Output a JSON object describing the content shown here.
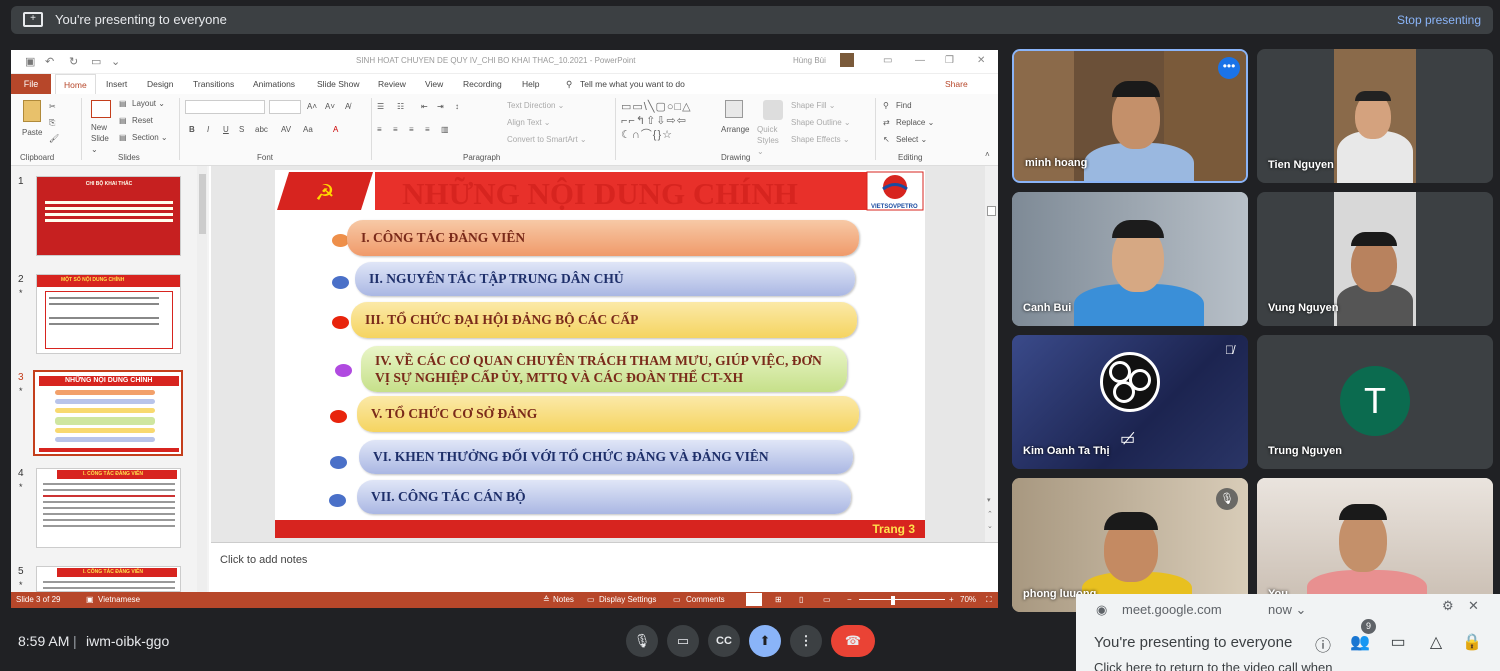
{
  "meet": {
    "presenting_text": "You're presenting to everyone",
    "stop_presenting": "Stop presenting",
    "time": "8:59 AM",
    "separator": "|",
    "meeting_code": "iwm-oibk-ggo",
    "participants_badge": "9",
    "toast": {
      "url": "meet.google.com",
      "when": "now ⌄",
      "message": "You're presenting to everyone",
      "sub": "Click here to return to the video call when"
    }
  },
  "powerpoint": {
    "doc_title": "SINH HOAT CHUYEN DE QUY IV_CHI BO KHAI THAC_10.2021  -  PowerPoint",
    "user": "Hùng Bùi",
    "tabs": [
      "File",
      "Home",
      "Insert",
      "Design",
      "Transitions",
      "Animations",
      "Slide Show",
      "Review",
      "View",
      "Recording",
      "Help",
      "Tell me what you want to do",
      "Share"
    ],
    "ribbon": {
      "paste": "Paste",
      "new_slide": "New Slide ⌄",
      "layout": "Layout ⌄",
      "reset": "Reset",
      "section": "Section ⌄",
      "text_direction": "Text Direction ⌄",
      "align_text": "Align Text ⌄",
      "convert_smartart": "Convert to SmartArt ⌄",
      "arrange": "Arrange",
      "quick_styles": "Quick Styles ⌄",
      "shape_fill": "Shape Fill ⌄",
      "shape_outline": "Shape Outline ⌄",
      "shape_effects": "Shape Effects ⌄",
      "find": "Find",
      "replace": "Replace ⌄",
      "select": "Select ⌄",
      "groups": [
        "Clipboard",
        "Slides",
        "Font",
        "Paragraph",
        "Drawing",
        "Editing"
      ]
    },
    "thumbnails": [
      {
        "num": "1",
        "title": "CHI BỘ KHAI THÁC"
      },
      {
        "num": "2",
        "title": "MỘT SỐ NỘI DUNG CHÍNH"
      },
      {
        "num": "3",
        "title": "NHỮNG NỘI DUNG CHÍNH"
      },
      {
        "num": "4",
        "title": "I. CÔNG TÁC ĐẢNG VIÊN"
      },
      {
        "num": "5",
        "title": "I. CÔNG TÁC ĐẢNG VIÊN"
      }
    ],
    "slide": {
      "title": "NHỮNG NỘI DUNG CHÍNH",
      "logo_text": "VIETSOVPETRO",
      "items": [
        "I. CÔNG TÁC ĐẢNG VIÊN",
        "II. NGUYÊN TẮC TẬP TRUNG DÂN CHỦ",
        "III. TỔ CHỨC ĐẠI HỘI ĐẢNG BỘ CÁC CẤP",
        "IV. VỀ CÁC CƠ QUAN CHUYÊN TRÁCH THAM MƯU, GIÚP VIỆC, ĐƠN VỊ SỰ NGHIỆP CẤP ỦY, MTTQ VÀ CÁC ĐOÀN THỂ CT-XH",
        "V. TỔ CHỨC CƠ SỞ ĐẢNG",
        "VI. KHEN THƯỞNG ĐỐI VỚI TỔ CHỨC ĐẢNG VÀ ĐẢNG VIÊN",
        "VII. CÔNG TÁC CÁN BỘ"
      ],
      "page": "Trang 3"
    },
    "notes_placeholder": "Click to add notes",
    "status": {
      "slide_of": "Slide 3 of 29",
      "language": "Vietnamese",
      "notes": "Notes",
      "display_settings": "Display Settings",
      "comments": "Comments",
      "zoom": "70%"
    }
  },
  "participants": [
    {
      "name": "minh hoang"
    },
    {
      "name": "Tien Nguyen"
    },
    {
      "name": "Canh Bui"
    },
    {
      "name": "Vung Nguyen"
    },
    {
      "name": "Kim Oanh Ta Thị"
    },
    {
      "name": "Trung Nguyen",
      "initial": "T"
    },
    {
      "name": "phong luuong"
    },
    {
      "name": "You"
    }
  ]
}
